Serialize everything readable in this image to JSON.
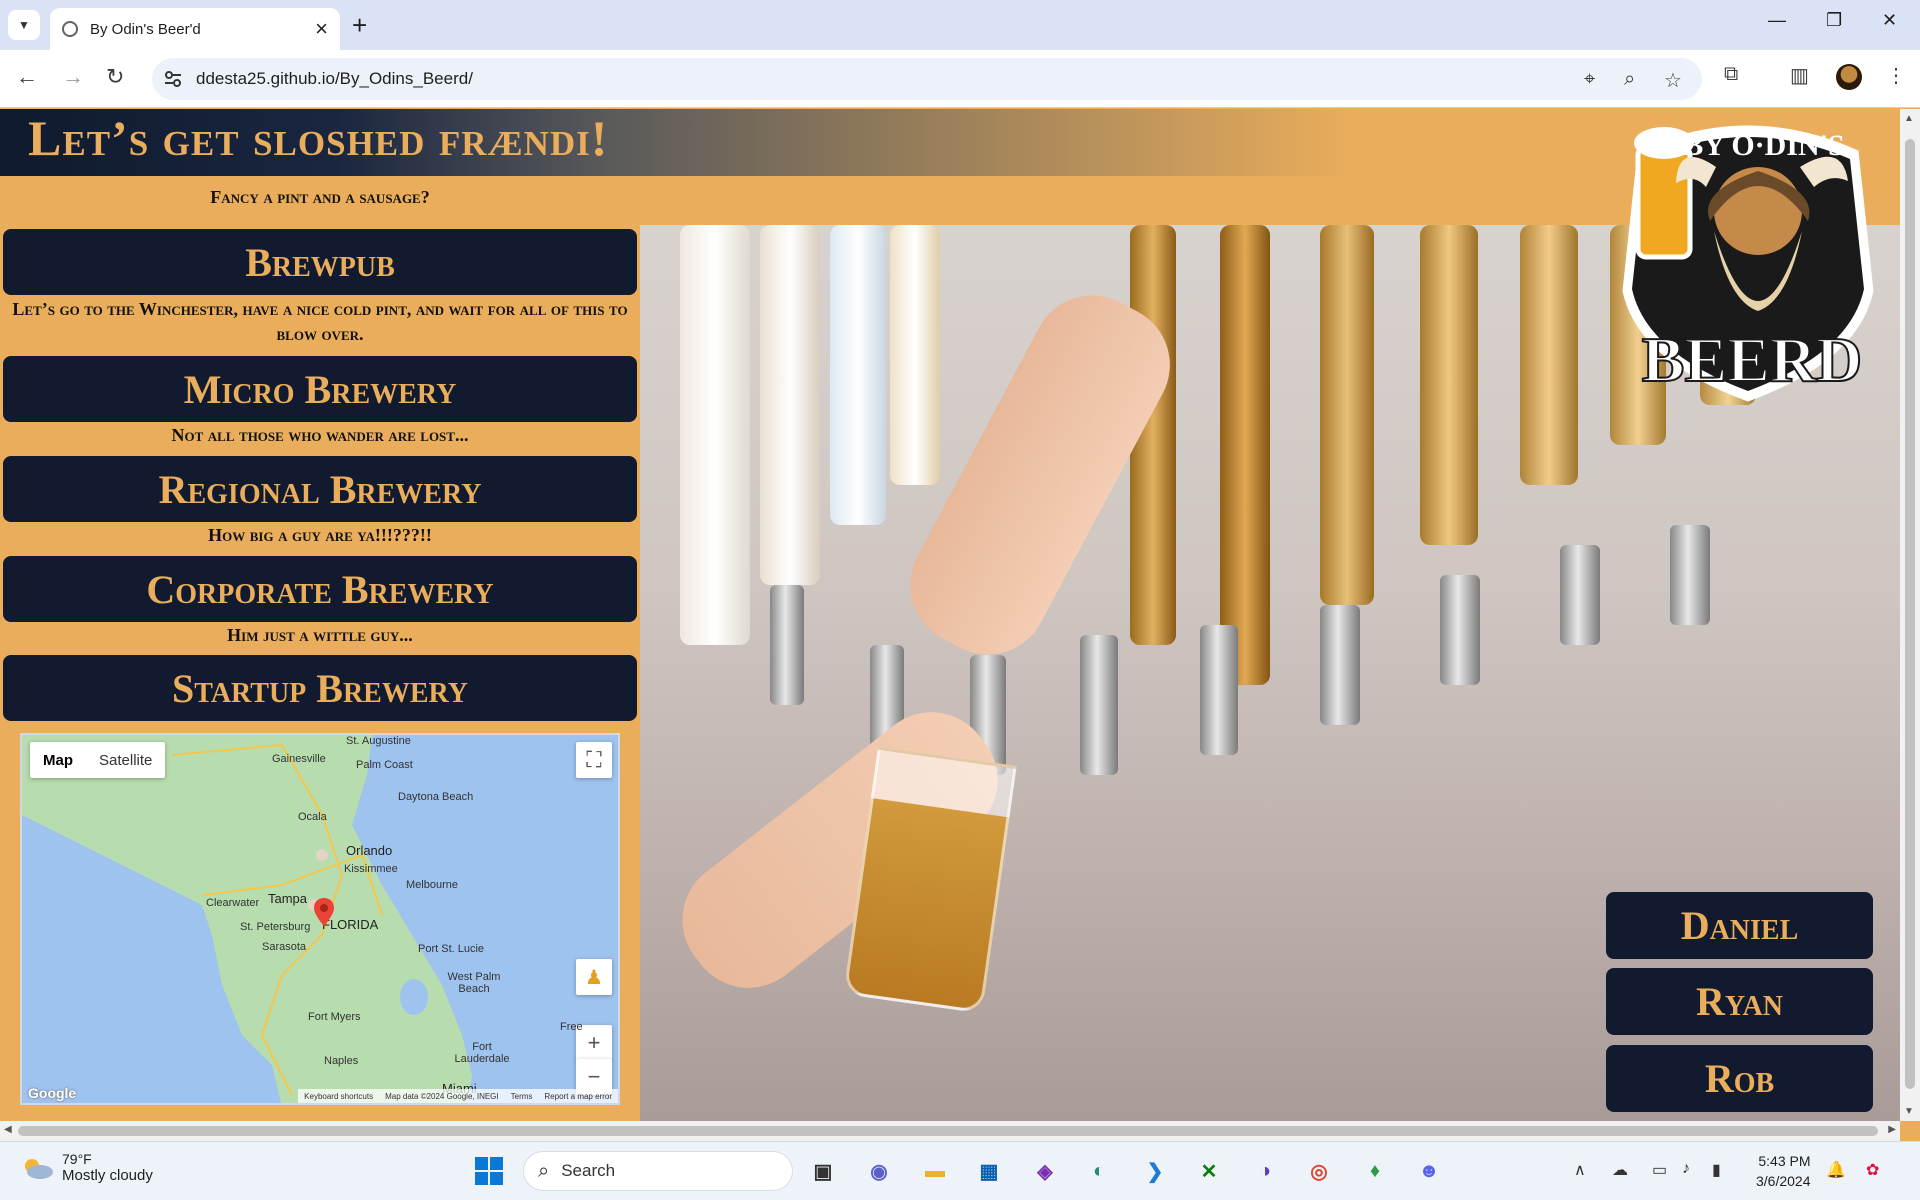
{
  "browser": {
    "tab_title": "By Odin's Beer'd",
    "url": "ddesta25.github.io/By_Odins_Beerd/"
  },
  "page": {
    "hero_title": "Let’s get sloshed frændi!",
    "tagline": "Fancy a pint and a sausage?",
    "categories": [
      {
        "label": "Brewpub",
        "desc": "Let’s go to the Winchester, have a nice cold pint, and wait for all of this to blow over."
      },
      {
        "label": "Micro Brewery",
        "desc": "Not all those who wander are lost..."
      },
      {
        "label": "Regional Brewery",
        "desc": "How big a guy are ya!!!???!!"
      },
      {
        "label": "Corporate Brewery",
        "desc": "Him just a wittle guy..."
      },
      {
        "label": "Startup Brewery",
        "desc": ""
      }
    ],
    "people": [
      "Daniel",
      "Ryan",
      "Rob"
    ],
    "logo_text": {
      "top": "BY O·DIN'S",
      "bottom": "BEERD"
    }
  },
  "map": {
    "type_map": "Map",
    "type_satellite": "Satellite",
    "labels": {
      "st_augustine": "St. Augustine",
      "gainesville": "Gainesville",
      "palm_coast": "Palm Coast",
      "daytona": "Daytona Beach",
      "ocala": "Ocala",
      "orlando": "Orlando",
      "kissimmee": "Kissimmee",
      "clearwater": "Clearwater",
      "tampa": "Tampa",
      "melbourne": "Melbourne",
      "florida": "FLORIDA",
      "st_petersburg": "St. Petersburg",
      "sarasota": "Sarasota",
      "port_st_lucie": "Port St. Lucie",
      "west_palm": "West Palm Beach",
      "fort_myers": "Fort Myers",
      "naples": "Naples",
      "fort_lauderdale": "Fort Lauderdale",
      "miami": "Miami",
      "freeport": "Free"
    },
    "footer": [
      "Keyboard shortcuts",
      "Map data ©2024 Google, INEGI",
      "Terms",
      "Report a map error"
    ],
    "google": "Google"
  },
  "taskbar": {
    "temp": "79°F",
    "condition": "Mostly cloudy",
    "search_placeholder": "Search",
    "time": "5:43 PM",
    "date": "3/6/2024"
  },
  "colors": {
    "accent": "#e9ad5b",
    "navy": "#111a2e"
  }
}
